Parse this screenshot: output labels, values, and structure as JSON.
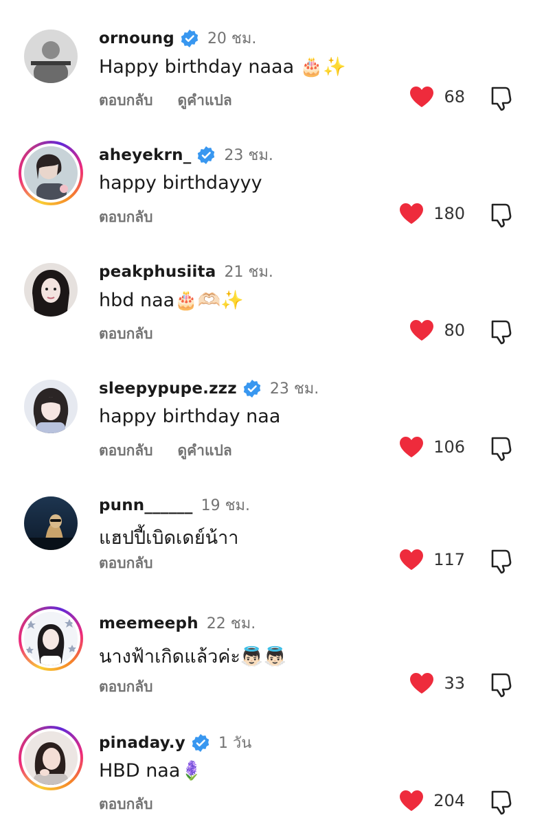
{
  "colors": {
    "heart": "#ee2b3c",
    "verified": "#3897f0",
    "muted_text": "#737373",
    "text": "#1a1a1a"
  },
  "actions": {
    "reply": "ตอบกลับ",
    "see_translation": "ดูคำแปล"
  },
  "comments": [
    {
      "username": "ornoung",
      "verified": true,
      "time": "20 ชม.",
      "text": "Happy birthday naaa 🎂✨",
      "likes": "68",
      "show_translation": true,
      "story_ring": false
    },
    {
      "username": "aheyekrn_",
      "verified": true,
      "time": "23 ชม.",
      "text": "happy birthdayyy",
      "likes": "180",
      "show_translation": false,
      "story_ring": true
    },
    {
      "username": "peakphusiita",
      "verified": false,
      "time": "21 ชม.",
      "text": "hbd naa🎂🫶🏻✨",
      "likes": "80",
      "show_translation": false,
      "story_ring": false
    },
    {
      "username": "sleepypupe.zzz",
      "verified": true,
      "time": "23 ชม.",
      "text": "happy birthday naa",
      "likes": "106",
      "show_translation": true,
      "story_ring": false
    },
    {
      "username": "punn______",
      "verified": false,
      "time": "19 ชม.",
      "text": "แฮปปี้เบิดเดย์น้าา",
      "likes": "117",
      "show_translation": false,
      "story_ring": false
    },
    {
      "username": "meemeeph",
      "verified": false,
      "time": "22 ชม.",
      "text": "นางฟ้าเกิดแล้วค่ะ👼🏻👼🏻",
      "likes": "33",
      "show_translation": false,
      "story_ring": true
    },
    {
      "username": "pinaday.y",
      "verified": true,
      "time": "1 วัน",
      "text": "HBD naa🪻",
      "likes": "204",
      "show_translation": false,
      "story_ring": true
    }
  ]
}
